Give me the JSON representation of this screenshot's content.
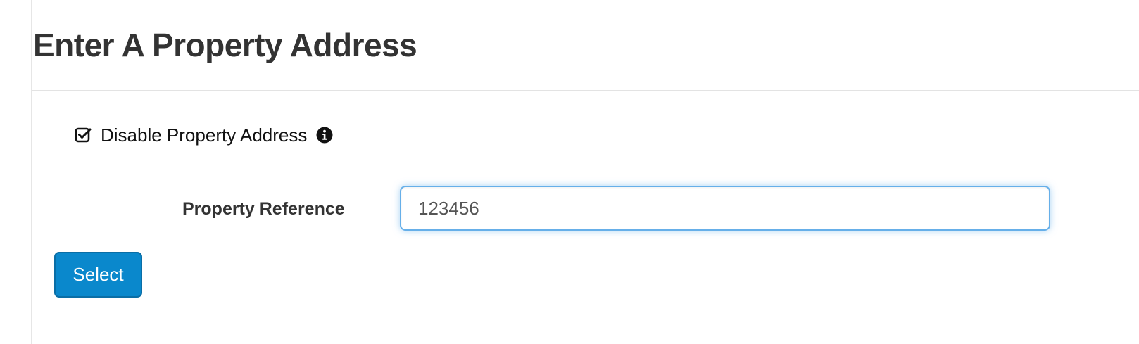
{
  "page": {
    "title": "Enter A Property Address"
  },
  "disable_address": {
    "label": "Disable Property Address",
    "checked": true,
    "icon": "checkbox-checked-icon",
    "info_icon": "info-circle-icon"
  },
  "property_reference": {
    "label": "Property Reference",
    "value": "123456",
    "focused": true
  },
  "actions": {
    "select_label": "Select"
  },
  "colors": {
    "button_bg": "#0a88cc",
    "focus_border": "#66afe9",
    "title_text": "#333333"
  }
}
